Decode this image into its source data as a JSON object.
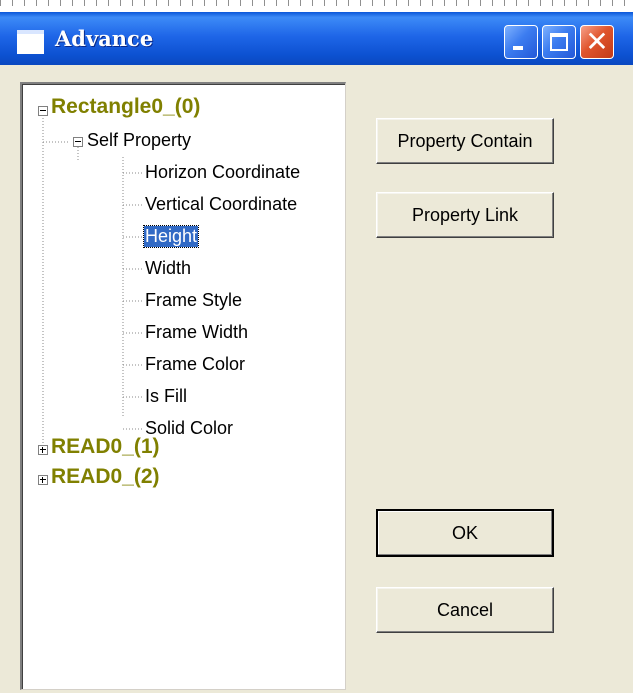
{
  "window": {
    "title": "Advance",
    "controls": {
      "minimize": "_",
      "maximize": "□",
      "close": "✕"
    }
  },
  "tree": {
    "roots": [
      {
        "label": "Rectangle0_(0)",
        "state": "expanded"
      },
      {
        "label": "READ0_(1)",
        "state": "collapsed"
      },
      {
        "label": "READ0_(2)",
        "state": "collapsed"
      }
    ],
    "group": {
      "label": "Self Property",
      "state": "expanded"
    },
    "properties": [
      "Horizon Coordinate",
      "Vertical Coordinate",
      "Height",
      "Width",
      "Frame Style",
      "Frame Width",
      "Frame Color",
      "Is Fill",
      "Solid Color"
    ],
    "selected": "Height"
  },
  "buttons": {
    "property_contain": "Property Contain",
    "property_link": "Property Link",
    "ok": "OK",
    "cancel": "Cancel"
  },
  "colors": {
    "titlebar": "#0A56D8",
    "dialog_bg": "#ECE9D8",
    "root_text": "#808000",
    "selection": "#316AC5",
    "close_button": "#E0552D"
  }
}
